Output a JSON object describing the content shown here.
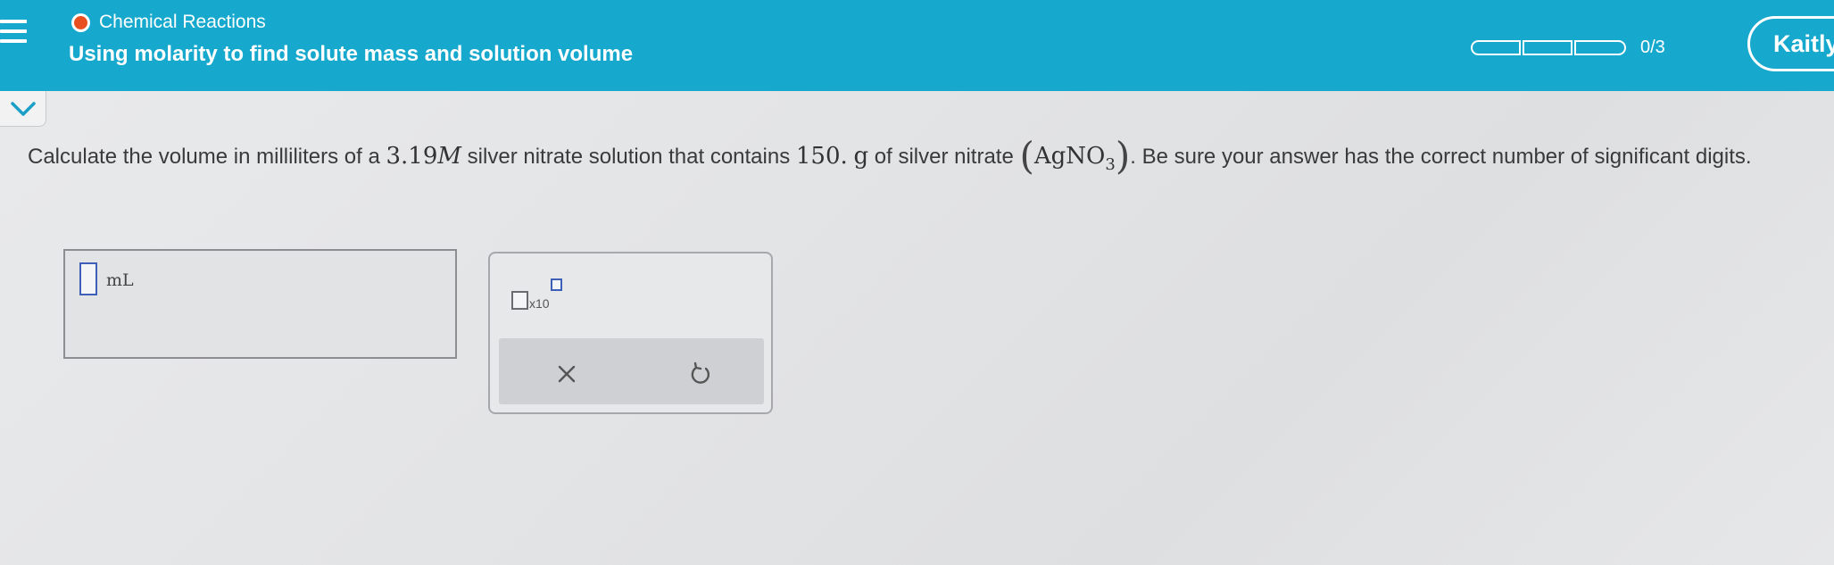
{
  "header": {
    "topic": "Chemical Reactions",
    "lesson_title": "Using molarity to find solute mass and solution volume",
    "progress_count": "0/3",
    "progress_fraction": 0,
    "user_name": "Kaitly",
    "accent_color": "#17a9cd",
    "topic_dot_color": "#e8511f"
  },
  "question": {
    "part1": "Calculate the volume in milliliters of a ",
    "molarity_value": "3.19",
    "molarity_unit": "M",
    "part2": " silver nitrate solution that contains ",
    "mass_value": "150.",
    "mass_unit": "g",
    "part3": " of silver nitrate ",
    "formula_main": "AgNO",
    "formula_sub": "3",
    "part4": ". Be sure your answer has the correct number of significant digits."
  },
  "answer": {
    "value": "",
    "unit": "mL"
  },
  "tools": {
    "sci_notation_label": "x10",
    "clear_icon": "close-icon",
    "undo_icon": "undo-icon"
  }
}
